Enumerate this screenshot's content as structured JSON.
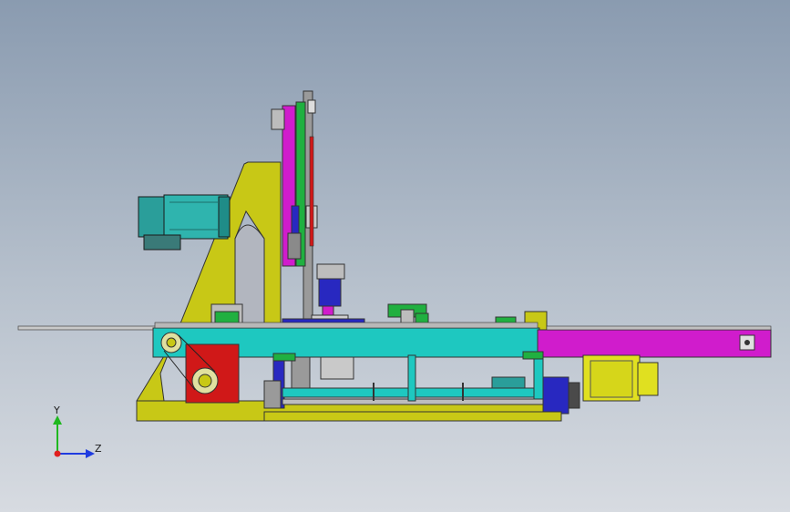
{
  "triad": {
    "y_label": "Y",
    "z_label": "Z",
    "y_color": "#1fb81f",
    "z_color": "#1f3ce0",
    "origin_color": "#e01f1f"
  },
  "palette": {
    "frame_yellow": "#c8c816",
    "rail_cyan": "#1ec8c0",
    "arm_magenta": "#d01ccc",
    "motor_teal": "#2a9e9a",
    "block_red": "#d01818",
    "plate_green": "#20b040",
    "block_blue": "#2828c0",
    "motor_yellow": "#e0e020",
    "gray": "#9a9a9a"
  }
}
